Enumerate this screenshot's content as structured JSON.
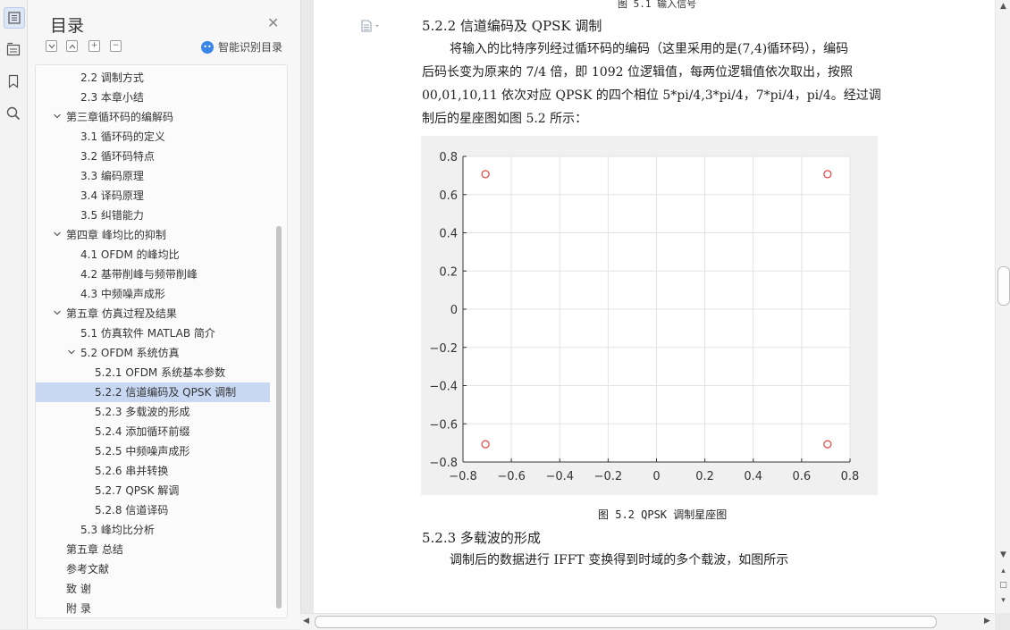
{
  "sidebar_icons": [
    "outline-icon",
    "navigation-icon",
    "bookmark-icon",
    "search-icon"
  ],
  "toc_panel": {
    "title": "目录",
    "smart_label": "智能识别目录",
    "items": [
      {
        "label": "2.2 调制方式",
        "level": 2,
        "selected": false
      },
      {
        "label": "2.3 本章小结",
        "level": 2,
        "selected": false
      },
      {
        "label": "第三章循环码的编解码",
        "level": 1,
        "expanded": true,
        "selected": false
      },
      {
        "label": "3.1  循环码的定义",
        "level": 2,
        "selected": false
      },
      {
        "label": "3.2 循环码特点",
        "level": 2,
        "selected": false
      },
      {
        "label": "3.3 编码原理",
        "level": 2,
        "selected": false
      },
      {
        "label": "3.4 译码原理",
        "level": 2,
        "selected": false
      },
      {
        "label": "3.5 纠错能力",
        "level": 2,
        "selected": false
      },
      {
        "label": "第四章  峰均比的抑制",
        "level": 1,
        "expanded": true,
        "selected": false
      },
      {
        "label": "4.1 OFDM 的峰均比",
        "level": 2,
        "selected": false
      },
      {
        "label": "4.2 基带削峰与频带削峰",
        "level": 2,
        "selected": false
      },
      {
        "label": "4.3 中频噪声成形",
        "level": 2,
        "selected": false
      },
      {
        "label": "第五章  仿真过程及结果",
        "level": 1,
        "expanded": true,
        "selected": false
      },
      {
        "label": "5.1 仿真软件 MATLAB 简介",
        "level": 2,
        "selected": false
      },
      {
        "label": "5.2 OFDM 系统仿真",
        "level": 2,
        "expanded": true,
        "selected": false
      },
      {
        "label": "5.2.1 OFDM 系统基本参数",
        "level": 3,
        "selected": false
      },
      {
        "label": "5.2.2 信道编码及 QPSK 调制",
        "level": 3,
        "selected": true
      },
      {
        "label": "5.2.3 多载波的形成",
        "level": 3,
        "selected": false
      },
      {
        "label": "5.2.4 添加循环前缀",
        "level": 3,
        "selected": false
      },
      {
        "label": "5.2.5 中频噪声成形",
        "level": 3,
        "selected": false
      },
      {
        "label": "5.2.6 串并转换",
        "level": 3,
        "selected": false
      },
      {
        "label": "5.2.7 QPSK 解调",
        "level": 3,
        "selected": false
      },
      {
        "label": "5.2.8 信道译码",
        "level": 3,
        "selected": false
      },
      {
        "label": "5.3  峰均比分析",
        "level": 2,
        "selected": false
      },
      {
        "label": "第五章  总结",
        "level": 1,
        "selected": false
      },
      {
        "label": " 参考文献",
        "level": 1,
        "selected": false
      },
      {
        "label": "致    谢",
        "level": 1,
        "selected": false
      },
      {
        "label": "附    录",
        "level": 1,
        "selected": false
      }
    ]
  },
  "document": {
    "top_caption": "图 5.1  输入信号",
    "section_heading": "5.2.2 信道编码及 QPSK 调制",
    "paragraph_lines": [
      "将输入的比特序列经过循环码的编码（这里采用的是(7,4)循环码），编码",
      "后码长变为原来的 7/4 倍，即 1092 位逻辑值，每两位逻辑值依次取出，按照",
      "00,01,10,11 依次对应 QPSK 的四个相位 5*pi/4,3*pi/4，7*pi/4，pi/4。经过调",
      "制后的星座图如图 5.2 所示："
    ],
    "figure_caption": "图 5.2  QPSK 调制星座图",
    "next_heading": "5.2.3 多载波的形成",
    "next_paragraph": "调制后的数据进行 IFFT 变换得到时域的多个载波，如图所示"
  },
  "chart_data": {
    "type": "scatter",
    "title": "",
    "xlabel": "",
    "ylabel": "",
    "xlim": [
      -0.8,
      0.8
    ],
    "ylim": [
      -0.8,
      0.8
    ],
    "xticks": [
      -0.8,
      -0.6,
      -0.4,
      -0.2,
      0,
      0.2,
      0.4,
      0.6,
      0.8
    ],
    "yticks": [
      -0.8,
      -0.6,
      -0.4,
      -0.2,
      0,
      0.2,
      0.4,
      0.6,
      0.8
    ],
    "xtick_labels": [
      "−0.8",
      "−0.6",
      "−0.4",
      "−0.2",
      "0",
      "0.2",
      "0.4",
      "0.6",
      "0.8"
    ],
    "ytick_labels": [
      "−0.8",
      "−0.6",
      "−0.4",
      "−0.2",
      "0",
      "0.2",
      "0.4",
      "0.6",
      "0.8"
    ],
    "grid": true,
    "marker": "circle",
    "marker_color": "#e8413e",
    "series": [
      {
        "points": [
          [
            -0.7071,
            0.7071
          ],
          [
            0.7071,
            0.7071
          ],
          [
            -0.7071,
            -0.7071
          ],
          [
            0.7071,
            -0.7071
          ]
        ]
      }
    ]
  }
}
